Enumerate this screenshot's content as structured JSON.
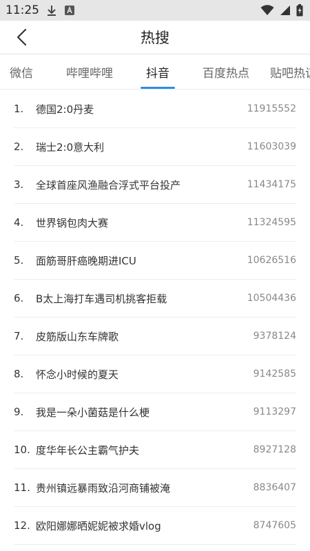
{
  "status": {
    "time": "11:25",
    "icons": [
      "download-icon",
      "keyboard-a-icon",
      "wifi-icon",
      "signal-icon",
      "battery-charging-icon"
    ]
  },
  "header": {
    "title": "热搜",
    "back_icon": "chevron-left-icon"
  },
  "tabs": [
    {
      "label": "微信",
      "active": false
    },
    {
      "label": "哔哩哔哩",
      "active": false
    },
    {
      "label": "抖音",
      "active": true
    },
    {
      "label": "百度热点",
      "active": false
    },
    {
      "label": "贴吧热议",
      "active": false
    }
  ],
  "accent_color": "#2a8bea",
  "list": [
    {
      "rank": "1.",
      "title": "德国2:0丹麦",
      "count": "11915552"
    },
    {
      "rank": "2.",
      "title": "瑞士2:0意大利",
      "count": "11603039"
    },
    {
      "rank": "3.",
      "title": "全球首座风渔融合浮式平台投产",
      "count": "11434175"
    },
    {
      "rank": "4.",
      "title": "世界锅包肉大赛",
      "count": "11324595"
    },
    {
      "rank": "5.",
      "title": "面筋哥肝癌晚期进ICU",
      "count": "10626516"
    },
    {
      "rank": "6.",
      "title": "B太上海打车遇司机挑客拒载",
      "count": "10504436"
    },
    {
      "rank": "7.",
      "title": "皮筋版山东车牌歌",
      "count": "9378124"
    },
    {
      "rank": "8.",
      "title": "怀念小时候的夏天",
      "count": "9142585"
    },
    {
      "rank": "9.",
      "title": "我是一朵小菌菇是什么梗",
      "count": "9113297"
    },
    {
      "rank": "10.",
      "title": "度华年长公主霸气护夫",
      "count": "8927128"
    },
    {
      "rank": "11.",
      "title": "贵州镇远暴雨致沿河商铺被淹",
      "count": "8836407"
    },
    {
      "rank": "12.",
      "title": "欧阳娜娜晒妮妮被求婚vlog",
      "count": "8747605"
    }
  ]
}
